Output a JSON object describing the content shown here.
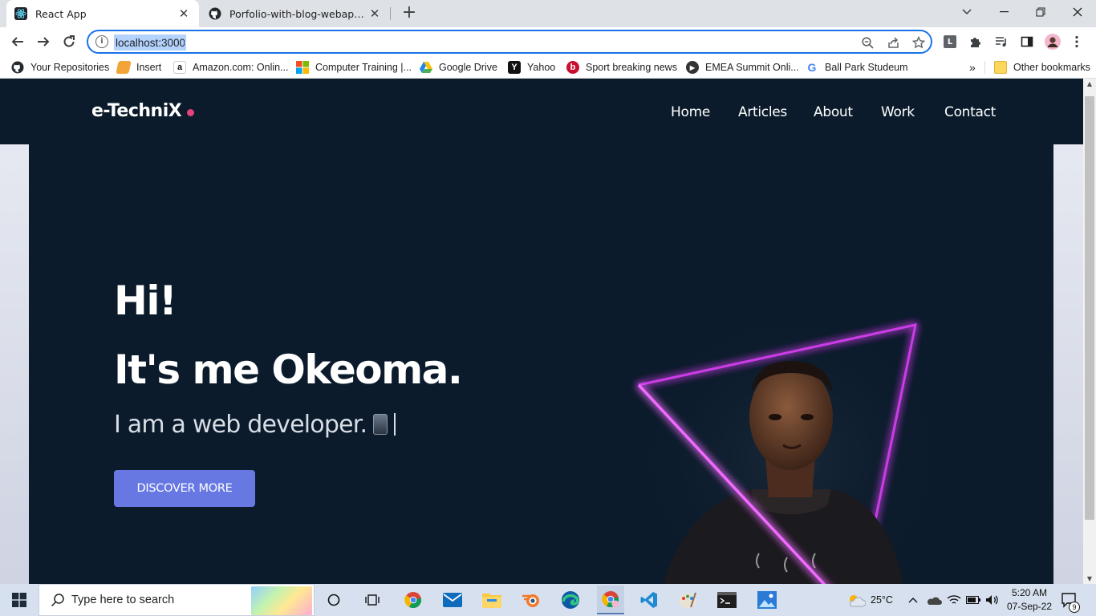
{
  "browser": {
    "tabs": [
      {
        "title": "React App",
        "icon": "react-icon",
        "active": true
      },
      {
        "title": "Porfolio-with-blog-webapp/READ",
        "icon": "github-icon",
        "active": false
      }
    ],
    "url": "localhost:3000",
    "bookmarks": [
      {
        "label": "Your Repositories",
        "icon": "github-icon"
      },
      {
        "label": "Insert",
        "icon": "bookmark-icon"
      },
      {
        "label": "Amazon.com: Onlin...",
        "icon": "amazon-icon"
      },
      {
        "label": "Computer Training |...",
        "icon": "microsoft-icon"
      },
      {
        "label": "Google Drive",
        "icon": "drive-icon"
      },
      {
        "label": "Yahoo",
        "icon": "yahoo-icon"
      },
      {
        "label": "Sport breaking news",
        "icon": "b-icon"
      },
      {
        "label": "EMEA Summit Onli...",
        "icon": "play-icon"
      },
      {
        "label": "Ball Park Studeum",
        "icon": "google-icon"
      }
    ],
    "bookmarks_overflow": "»",
    "other_bookmarks": "Other bookmarks"
  },
  "site": {
    "logo": "e-TechniX",
    "nav": [
      "Home",
      "Articles",
      "About",
      "Work",
      "Contact"
    ],
    "hero": {
      "greeting": "Hi!",
      "headline": "It's me Okeoma.",
      "role": "I am a web developer.",
      "cta": "DISCOVER MORE"
    },
    "accent_colors": {
      "dot": "#e4447b",
      "button": "#6778e3",
      "neon": "#e040fb",
      "background": "#0b1b2b"
    }
  },
  "taskbar": {
    "search_placeholder": "Type here to search",
    "weather": "25°C",
    "time": "5:20 AM",
    "date": "07-Sep-22",
    "notifications": "9"
  }
}
